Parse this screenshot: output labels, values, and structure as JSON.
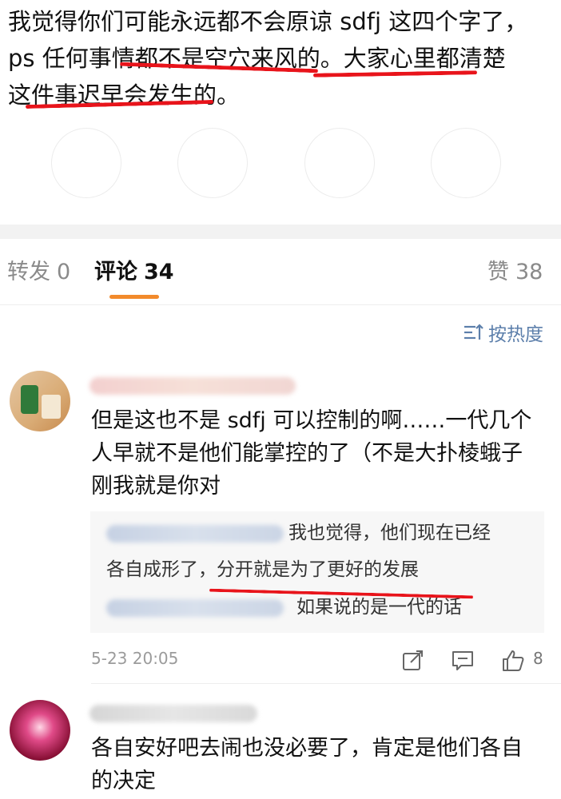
{
  "post": {
    "lines": [
      "我觉得你们可能永远都不会原谅 sdfj 这四个字了，",
      "ps 任何事情都不是空穴来风的。大家心里都清楚",
      "这件事迟早会发生的。"
    ]
  },
  "tabs": [
    {
      "label": "转发",
      "count": "0"
    },
    {
      "label": "评论",
      "count": "34"
    },
    {
      "label": "赞",
      "count": "38"
    }
  ],
  "sort": {
    "label": "按热度",
    "icon": "sort-icon"
  },
  "comments": [
    {
      "text_lines": [
        "但是这也不是 sdfj 可以控制的啊……一代几个",
        "人早就不是他们能掌控的了（不是大扑棱蛾子",
        "刚我就是你对"
      ],
      "replies": [
        {
          "lines": [
            "我也觉得，他们现在已经",
            "各自成形了，分开就是为了更好的发展"
          ]
        },
        {
          "lines": [
            "如果说的是一代的话"
          ]
        }
      ],
      "time": "5-23 20:05",
      "like_count": "8",
      "icons": [
        "share-icon",
        "reply-icon",
        "like-icon"
      ]
    },
    {
      "text_lines": [
        "各自安好吧去闹也没必要了，肯定是他们各自",
        "的决定"
      ]
    }
  ],
  "colors": {
    "annotation_red": "#e8141b",
    "tab_underline": "#f28a2b",
    "sort_blue": "#5c7fab"
  }
}
